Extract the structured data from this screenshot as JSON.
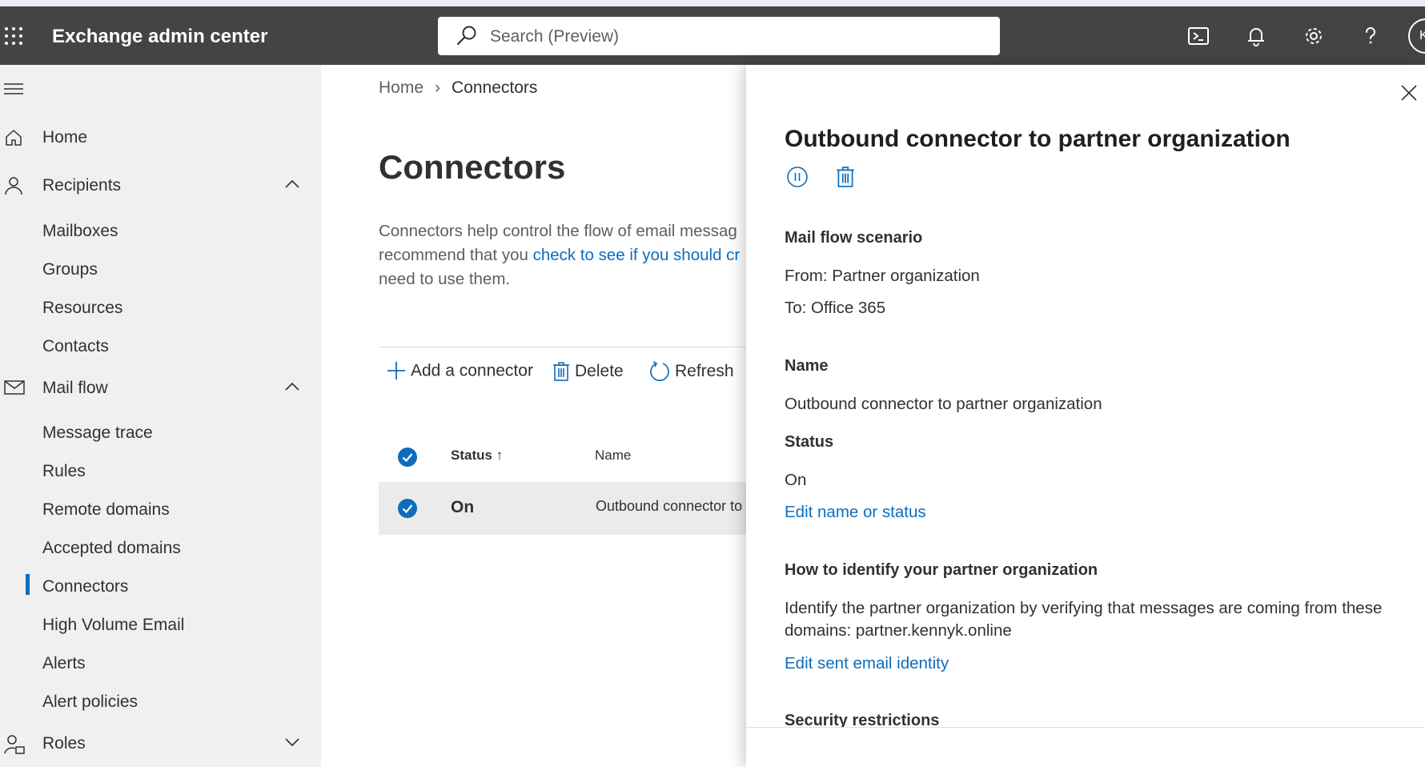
{
  "header": {
    "app_title": "Exchange admin center",
    "search_placeholder": "Search (Preview)",
    "avatar_initial": "K",
    "icons": [
      "app-launcher-icon",
      "search-icon",
      "cloud-shell-icon",
      "bell-icon",
      "gear-icon",
      "help-icon"
    ]
  },
  "sidebar": {
    "items": [
      {
        "label": "Home",
        "icon": "home-icon"
      },
      {
        "label": "Recipients",
        "icon": "person-icon",
        "expanded": true,
        "children": [
          "Mailboxes",
          "Groups",
          "Resources",
          "Contacts"
        ]
      },
      {
        "label": "Mail flow",
        "icon": "mail-icon",
        "expanded": true,
        "children": [
          "Message trace",
          "Rules",
          "Remote domains",
          "Accepted domains",
          "Connectors",
          "High Volume Email",
          "Alerts",
          "Alert policies"
        ]
      },
      {
        "label": "Roles",
        "icon": "roles-icon",
        "expanded": false
      }
    ],
    "active": "Connectors"
  },
  "main": {
    "breadcrumb": {
      "home": "Home",
      "current": "Connectors"
    },
    "title": "Connectors",
    "description_1": "Connectors help control the flow of email messag",
    "description_2": "recommend that you ",
    "description_link": "check to see if you should cr",
    "description_3": "need to use them.",
    "toolbar": {
      "add": "Add a connector",
      "delete": "Delete",
      "refresh": "Refresh"
    },
    "table": {
      "columns": [
        "Status",
        "Name"
      ],
      "sort_indicator": "↑",
      "rows": [
        {
          "status": "On",
          "name": "Outbound connector to"
        }
      ]
    }
  },
  "panel": {
    "title": "Outbound connector to partner organization",
    "sections": {
      "scenario_heading": "Mail flow scenario",
      "from": "From: Partner organization",
      "to": "To: Office 365",
      "name_heading": "Name",
      "name_value": "Outbound connector to partner organization",
      "status_heading": "Status",
      "status_value": "On",
      "edit_name_link": "Edit name or status",
      "identify_heading": "How to identify your partner organization",
      "identify_text": "Identify the partner organization by verifying that messages are coming from these domains: partner.kennyk.online",
      "edit_identity_link": "Edit sent email identity",
      "security_heading": "Security restrictions"
    }
  },
  "colors": {
    "accent": "#0f6cbd",
    "topbar": "#444444",
    "sidebar": "#f0f0f0"
  }
}
